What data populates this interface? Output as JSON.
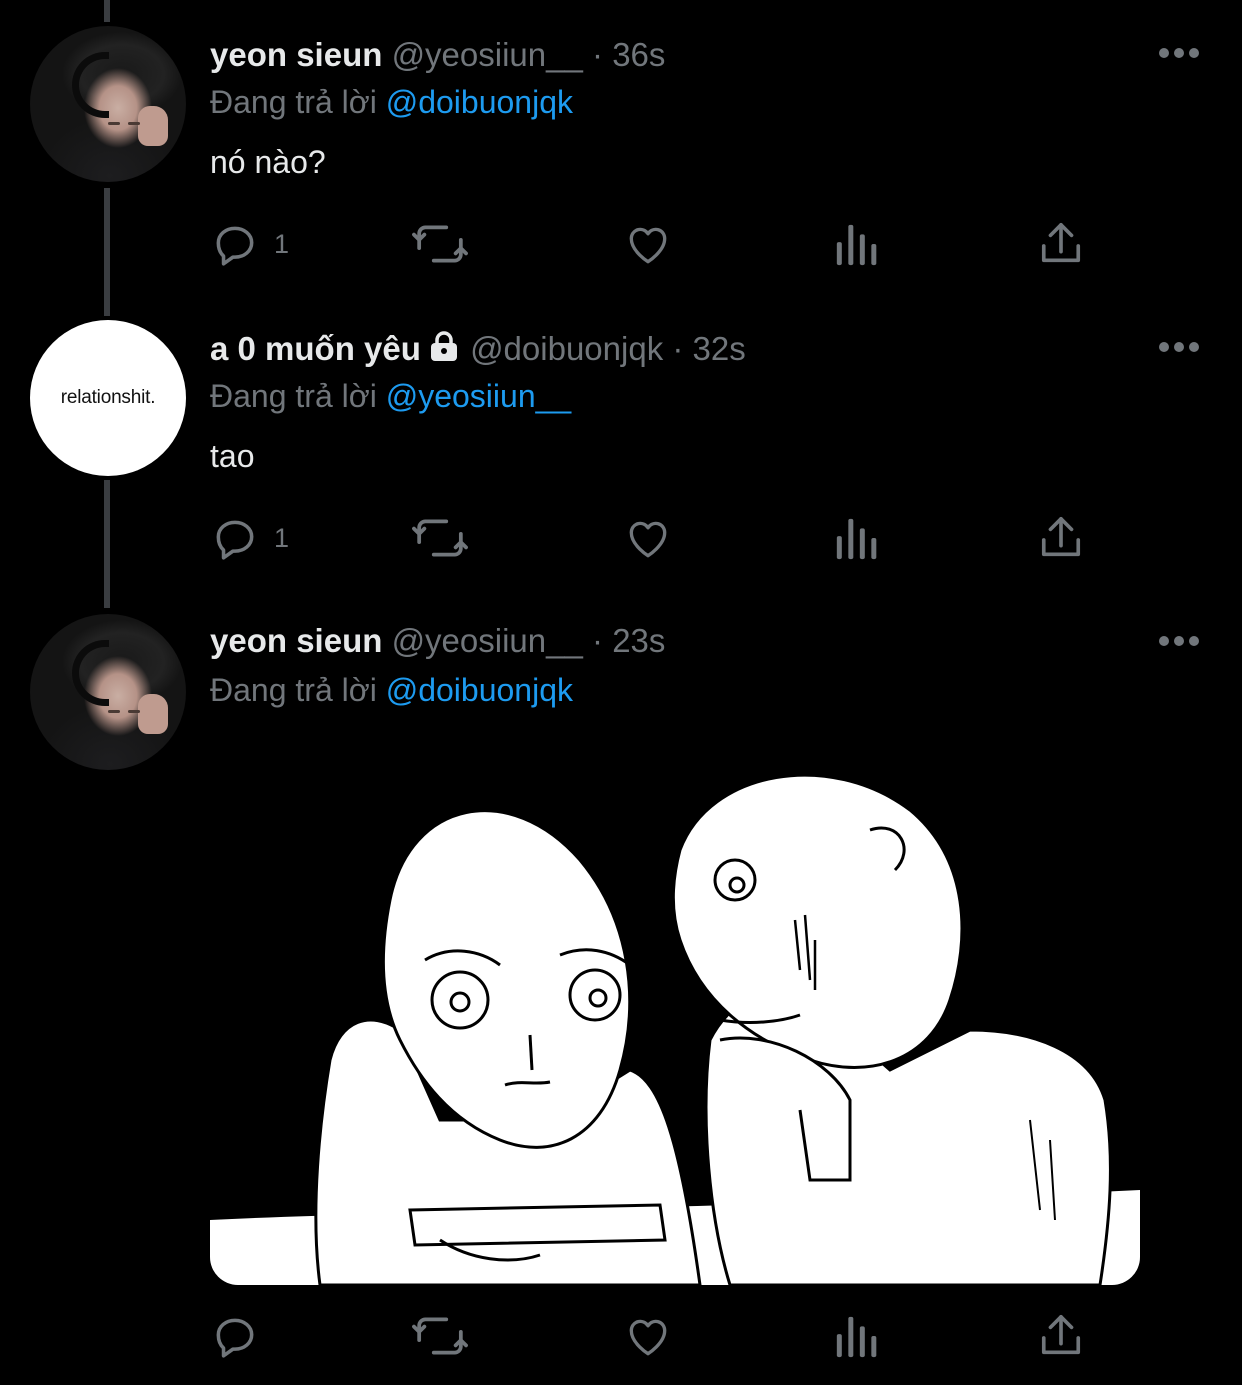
{
  "colors": {
    "background": "#000000",
    "primary_text": "#e7e9ea",
    "secondary_text": "#71767b",
    "link": "#1d9bf0",
    "thread_line": "#3a3d41"
  },
  "icons": {
    "more": "more-horizontal-icon",
    "reply": "reply-bubble-icon",
    "retweet": "retweet-icon",
    "like": "heart-icon",
    "views": "bar-chart-icon",
    "share": "share-upload-icon",
    "lock": "lock-icon"
  },
  "tweets": [
    {
      "display_name": "yeon sieun",
      "handle": "@yeosiiun__",
      "separator": "·",
      "time": "36s",
      "replying_label": "Đang trả lời",
      "replying_to": "@doibuonjqk",
      "text": "nó nào?",
      "reply_count": "1"
    },
    {
      "display_name": "a 0 muốn yêu",
      "handle": "@doibuonjqk",
      "separator": "·",
      "time": "32s",
      "replying_label": "Đang trả lời",
      "replying_to": "@yeosiiun__",
      "text": "tao",
      "reply_count": "1",
      "avatar_text": "relationshit."
    },
    {
      "display_name": "yeon sieun",
      "handle": "@yeosiiun__",
      "separator": "·",
      "time": "23s",
      "replying_label": "Đang trả lời",
      "replying_to": "@doibuonjqk",
      "text": "",
      "reply_count": ""
    }
  ]
}
